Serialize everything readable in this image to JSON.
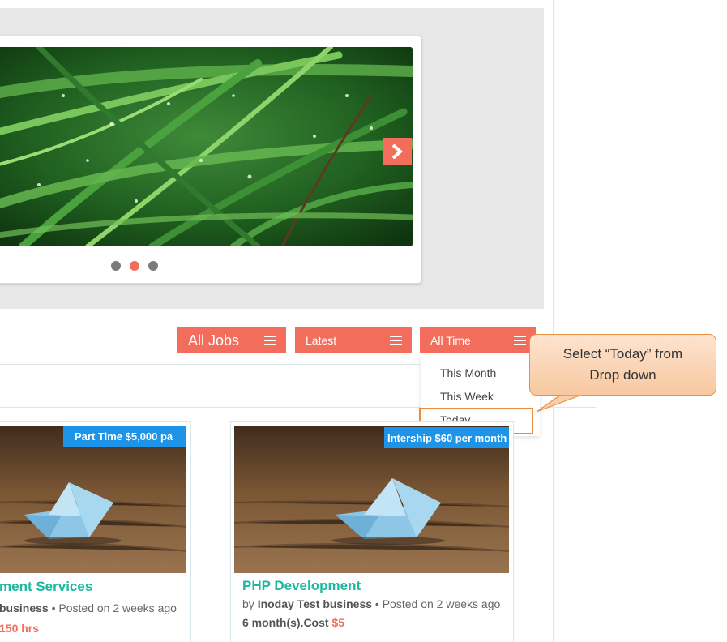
{
  "slider": {
    "dots_active_index": 1
  },
  "filters": {
    "jobs_label": "All Jobs",
    "sort_label": "Latest",
    "time_label": "All Time",
    "time_options": [
      "This Month",
      "This Week",
      "Today"
    ]
  },
  "callout": {
    "text_line1": "Select “Today” from",
    "text_line2": "Drop down"
  },
  "jobs": [
    {
      "badge": "Part Time $5,000 pa",
      "title": "ment Services",
      "business": "business",
      "posted": "Posted on 2 weeks ago",
      "detail": "150 hrs"
    },
    {
      "badge": "Intership $60 per month",
      "title": "PHP Development",
      "by": "by",
      "business": "Inoday Test business",
      "posted": "Posted on 2 weeks ago",
      "duration": "6 month(s).Cost",
      "cost": "$5"
    }
  ],
  "colors": {
    "accent": "#f26d5b",
    "badge": "#1d94e8",
    "title": "#1cb8a0",
    "callout_border": "#e8923e"
  }
}
